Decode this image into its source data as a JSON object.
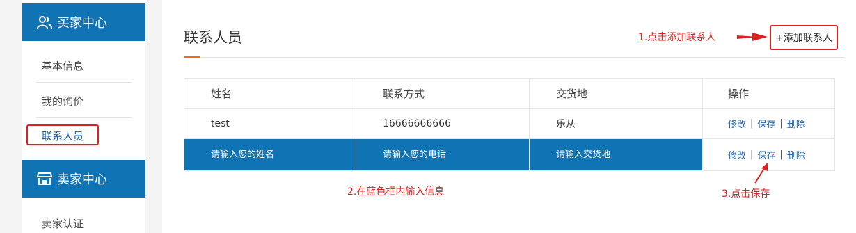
{
  "sidebar": {
    "buyer_center": "买家中心",
    "items": [
      {
        "label": "基本信息"
      },
      {
        "label": "我的询价"
      },
      {
        "label": "联系人员"
      }
    ],
    "seller_center": "卖家中心",
    "seller_items": [
      {
        "label": "卖家认证"
      }
    ]
  },
  "main": {
    "title": "联系人员",
    "add_button": "+添加联系人",
    "annotations": {
      "step1": "1.点击添加联系人",
      "step2": "2.在蓝色框内输入信息",
      "step3": "3.点击保存"
    },
    "table": {
      "headers": [
        "姓名",
        "联系方式",
        "交货地",
        "操作"
      ],
      "rows": [
        {
          "name": "test",
          "phone": "16666666666",
          "location": "乐从"
        }
      ],
      "edit_row": {
        "name_placeholder": "请输入您的姓名",
        "phone_placeholder": "请输入您的电话",
        "location_placeholder": "请输入交货地"
      },
      "actions": {
        "edit": "修改",
        "save": "保存",
        "delete": "删除",
        "separator": "|"
      }
    }
  },
  "colors": {
    "primary_blue": "#0f73b4",
    "annotation_red": "#e0201e",
    "accent_orange": "#f26b1d",
    "link_blue": "#1a5fa8"
  }
}
